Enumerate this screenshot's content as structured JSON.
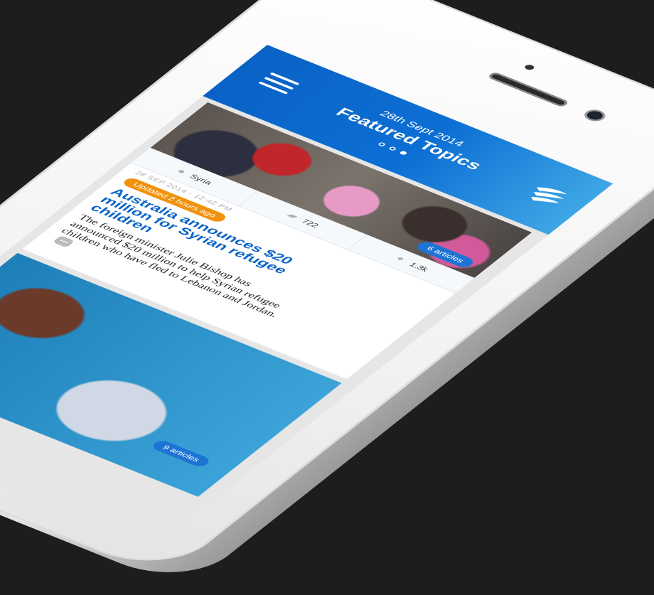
{
  "header": {
    "date": "28th Sept 2014",
    "title": "Featured Topics",
    "page_dots": 3,
    "active_dot": 3,
    "colors": {
      "start": "#0a62c6",
      "end": "#3ea6e6"
    }
  },
  "featured_card": {
    "articles_badge": "6 articles",
    "stats": {
      "location": "Syria",
      "comments": "722",
      "tweets": "1.3k"
    },
    "date": "28 SEP 2014 - 12:42 PM",
    "updated": "Updated 2 hours ago",
    "title": "Australia announces $20 million for Syrian refugee children",
    "summary": "The foreign minister Julie Bishop has announced $20 million to help Syrian refugee children who have fled to Lebanon and Jordan.",
    "more": "•••"
  },
  "second_card": {
    "articles_badge": "9 articles"
  },
  "colors": {
    "accent": "#0a64c8",
    "updated_badge": "#f0920c",
    "background": "#1d1d1d"
  }
}
